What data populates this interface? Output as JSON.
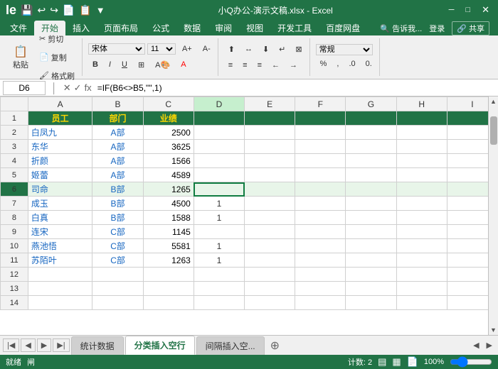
{
  "titleBar": {
    "title": "小Q办公-演示文稿.xlsx - Excel",
    "minimize": "─",
    "maximize": "□",
    "close": "✕",
    "icons": [
      "💾",
      "↩",
      "↪",
      "📄",
      "📋"
    ]
  },
  "ribbonTabs": [
    "文件",
    "开始",
    "插入",
    "页面布局",
    "公式",
    "数据",
    "审阅",
    "视图",
    "开发工具",
    "百度网盘"
  ],
  "activeTab": "开始",
  "rightActions": [
    "告诉我...",
    "登录",
    "共享"
  ],
  "formulaBar": {
    "cellRef": "D6",
    "formula": "=IF(B6<>B5,\"\",1)"
  },
  "columns": [
    "",
    "A",
    "B",
    "C",
    "D",
    "E",
    "F",
    "G",
    "H",
    "I"
  ],
  "rows": [
    {
      "rowNum": 1,
      "A": "员工",
      "B": "部门",
      "C": "业绩",
      "D": "",
      "E": "",
      "F": "",
      "G": "",
      "H": "",
      "I": "",
      "isHeader": true
    },
    {
      "rowNum": 2,
      "A": "白凤九",
      "B": "A部",
      "C": "2500",
      "D": "",
      "E": "",
      "F": "",
      "G": "",
      "H": "",
      "I": ""
    },
    {
      "rowNum": 3,
      "A": "东华",
      "B": "A部",
      "C": "3625",
      "D": "",
      "E": "",
      "F": "",
      "G": "",
      "H": "",
      "I": ""
    },
    {
      "rowNum": 4,
      "A": "折颜",
      "B": "A部",
      "C": "1566",
      "D": "",
      "E": "",
      "F": "",
      "G": "",
      "H": "",
      "I": ""
    },
    {
      "rowNum": 5,
      "A": "姬蕾",
      "B": "A部",
      "C": "4589",
      "D": "",
      "E": "",
      "F": "",
      "G": "",
      "H": "",
      "I": ""
    },
    {
      "rowNum": 6,
      "A": "司命",
      "B": "B部",
      "C": "1265",
      "D": "",
      "E": "",
      "F": "",
      "G": "",
      "H": "",
      "I": "",
      "isSelected": true
    },
    {
      "rowNum": 7,
      "A": "成玉",
      "B": "B部",
      "C": "4500",
      "D": "1",
      "E": "",
      "F": "",
      "G": "",
      "H": "",
      "I": ""
    },
    {
      "rowNum": 8,
      "A": "白真",
      "B": "B部",
      "C": "1588",
      "D": "1",
      "E": "",
      "F": "",
      "G": "",
      "H": "",
      "I": ""
    },
    {
      "rowNum": 9,
      "A": "连宋",
      "B": "C部",
      "C": "1145",
      "D": "",
      "E": "",
      "F": "",
      "G": "",
      "H": "",
      "I": ""
    },
    {
      "rowNum": 10,
      "A": "燕池悟",
      "B": "C部",
      "C": "5581",
      "D": "1",
      "E": "",
      "F": "",
      "G": "",
      "H": "",
      "I": ""
    },
    {
      "rowNum": 11,
      "A": "苏陌叶",
      "B": "C部",
      "C": "1263",
      "D": "1",
      "E": "",
      "F": "",
      "G": "",
      "H": "",
      "I": ""
    },
    {
      "rowNum": 12,
      "A": "",
      "B": "",
      "C": "",
      "D": "",
      "E": "",
      "F": "",
      "G": "",
      "H": "",
      "I": ""
    },
    {
      "rowNum": 13,
      "A": "",
      "B": "",
      "C": "",
      "D": "",
      "E": "",
      "F": "",
      "G": "",
      "H": "",
      "I": ""
    },
    {
      "rowNum": 14,
      "A": "",
      "B": "",
      "C": "",
      "D": "",
      "E": "",
      "F": "",
      "G": "",
      "H": "",
      "I": ""
    }
  ],
  "sheetTabs": [
    {
      "name": "统计数据",
      "active": false
    },
    {
      "name": "分类插入空行",
      "active": true
    },
    {
      "name": "间隔插入空...",
      "active": false
    }
  ],
  "statusBar": {
    "left": [
      "就绪",
      "闸"
    ],
    "count": "计数: 2",
    "zoom": "100%",
    "viewIcons": [
      "▤",
      "▦",
      "📄"
    ]
  }
}
